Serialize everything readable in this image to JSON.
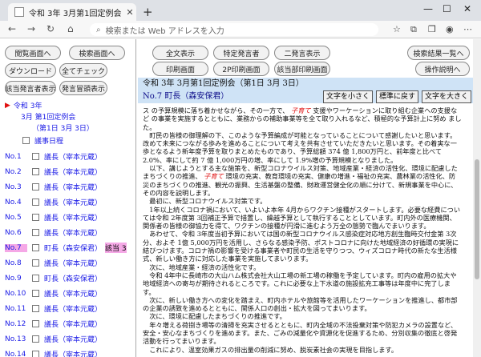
{
  "browser": {
    "tab_title": "令和 3年 3月第1回定例会（第1",
    "address_placeholder": "検索または Web アドレスを入力"
  },
  "left_buttons": [
    {
      "label": "閲覧画面へ"
    },
    {
      "label": "検索画面へ"
    },
    {
      "label": "ダウンロード"
    },
    {
      "label": "全てチェック"
    },
    {
      "label": "該当発言者表示"
    },
    {
      "label": "発言冒頭表示"
    }
  ],
  "tree": {
    "year": "令和 3年",
    "session": "3月 第1回定例会",
    "day": "（第1日 3月 3日）",
    "agenda": "議事日程"
  },
  "items": [
    {
      "no": "No.1",
      "name": "議長（宰本元蔵）",
      "hit": ""
    },
    {
      "no": "No.2",
      "name": "議長（宰本元蔵）",
      "hit": ""
    },
    {
      "no": "No.3",
      "name": "議長（宰本元蔵）",
      "hit": ""
    },
    {
      "no": "No.4",
      "name": "議長（宰本元蔵）",
      "hit": ""
    },
    {
      "no": "No.5",
      "name": "議長（宰本元蔵）",
      "hit": ""
    },
    {
      "no": "No.6",
      "name": "議長（宰本元蔵）",
      "hit": ""
    },
    {
      "no": "No.7",
      "name": "町長（森安保君）",
      "hit": "該当 3"
    },
    {
      "no": "No.8",
      "name": "議長（宰本元蔵）",
      "hit": ""
    },
    {
      "no": "No.9",
      "name": "町長（森安保君）",
      "hit": ""
    },
    {
      "no": "No.10",
      "name": "議長（宰本元蔵）",
      "hit": ""
    },
    {
      "no": "No.11",
      "name": "議長（宰本元蔵）",
      "hit": ""
    },
    {
      "no": "No.12",
      "name": "議長（宰本元蔵）",
      "hit": ""
    },
    {
      "no": "No.13",
      "name": "議長（宰本元蔵）",
      "hit": ""
    },
    {
      "no": "No.14",
      "name": "議長（宰本元蔵）",
      "hit": ""
    }
  ],
  "top_buttons": [
    {
      "label": "全文表示"
    },
    {
      "label": "特定発言者"
    },
    {
      "label": "二発言表示"
    },
    {
      "label": "印刷画面"
    },
    {
      "label": "2P印刷画面"
    },
    {
      "label": "該当部印刷画面"
    },
    {
      "label": "検索結果一覧へ"
    },
    {
      "label": "操作説明へ"
    }
  ],
  "title": "令和 3年 3月第1回定例会（第1日 3月 3日）",
  "speaker": "No.7 町長（森安保君）",
  "font_buttons": {
    "small": "文字を小さく",
    "normal": "標準に戻す",
    "large": "文字を大きく"
  },
  "body": [
    "ス の予算規模に落ち着かせながら、その一方で、 子育て 支援やワーケーションに取り組む企業への支援な ど の事業を実施するとともに、業務からの補助事業等を全て取り入れるなど、積極的な予算計上に努め ました。",
    "　町民の皆様の御理解の下、このような予算編成が可能となっていることについて感謝したいと思います。改めて未来につながる歩みを進めることについて考えを共有させていただきたいと思います。その着実な一歩となるよう新年度予算を取りまとめたものであり、予算総額 374 億 1,800万円と、前年度と比べて 2.0%、率にして約 7 億 1,000万円の増、率にして 1.9%増の予算規模となりました。",
    "　以下、講じようとする主な施策を、新型コロナウイルス対策、地域産業・経済の活性化、環境に配慮したまちづくりの推進、 子育て 環境の充実、教育環境の充実、健康の増進・福祉の充実、農林業の活性化、防災のまちづくりの推進、観光の振興、生活基盤の整備、財政運営健全化の順に分けて、新規事業を中心に、その内容を説明します。",
    "　最初に、新型コロナウイルス対策です。",
    "　1年以上続くコロナ禍において、いよいよ本年 4月からワクチン接種がスタートします。必要な経費については令和 2年度第 3回補正予算で措置し、繰越予算として執行することとしています。町内外の医療機関、関係者の皆様の御協力を得て、ワクチンの接種が円滑に進むよう万全の態勢で臨んでまいります。",
    "　あわせて、令和 3年度当初予算においては国の新型コロナウイルス感染症対応地方創生臨時交付金第 3次分、およそ 1億 5,000万円を活用し、さらなる感染予防、ポストコロナに向けた地域経済の好循環の実現に結びつけます。コロナ禍の影響を受ける事業者や町民の生活を守りつつ、ウィズコロナ時代の新たな生活様式、新しい働き方に対応した事業を実施してまいります。",
    "　次に、地域産業・経済の活性化です。",
    "　令和 4年中に長崎市の大山ハム株式会社大山工場の新工場の稼働を予定しています。町内の雇用の拡大や地域経済への寄与が期待されるところです。これに必要な上下水道の施設拡充工事等は年度中に完了します。",
    "　次に、新しい働き方への変化を踏まえ、町内ホテルや旅館等を活用したワーケーションを推進し、都市部の企業の誘致を進めるとともに、関係人口の創出・拡大を図ってまいります。",
    "　次に、環境に配慮したまちづくりの推進です。",
    "　年々増える荷捌き場等の清掃を充実させるとともに、町内全域の不法投棄対策や防犯カメラの設置など、安全・安心なまちづくりを進めます。また、ごみの減量化や資源化を促進するため、分別収集の徹底と啓発活動を行ってまいります。",
    "　これにより、温室効果ガスの排出量の削減に努め、脱炭素社会の実現を目指します。"
  ]
}
